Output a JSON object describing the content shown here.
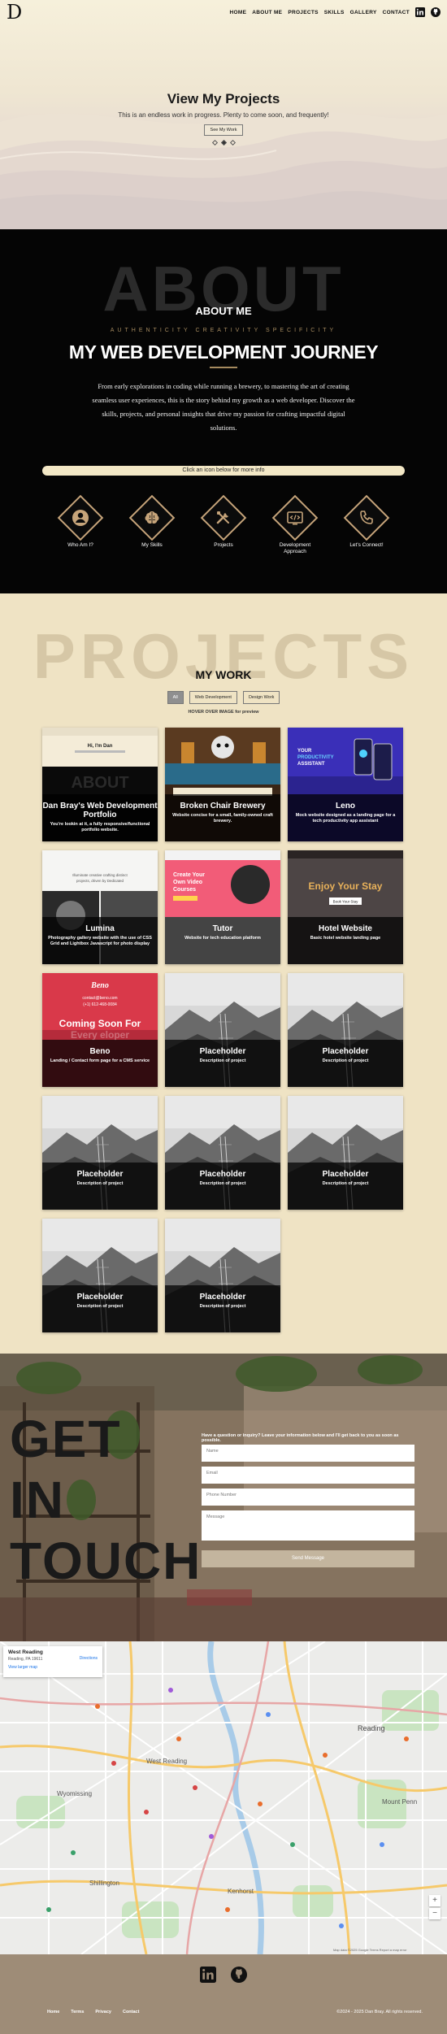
{
  "nav": {
    "logo": "D",
    "links": [
      "HOME",
      "ABOUT ME",
      "PROJECTS",
      "SKILLS",
      "GALLERY",
      "CONTACT"
    ],
    "icons": [
      "linkedin-icon",
      "github-icon"
    ]
  },
  "hero": {
    "title": "View My Projects",
    "subtitle": "This is an endless work in progress. Plenty to come soon, and frequently!",
    "button": "See My Work"
  },
  "about": {
    "bg_word": "ABOUT",
    "heading": "ABOUT ME",
    "tagline": "AUTHENTICITY  CREATIVITY  SPECIFICITY",
    "title": "MY WEB DEVELOPMENT JOURNEY",
    "text": "From early explorations in coding while running a brewery, to mastering the art of creating seamless user experiences, this is the story behind my growth as a web developer. Discover the skills, projects, and personal insights that drive my passion for crafting impactful digital solutions.",
    "bar": "Click an icon below for more info",
    "icons": [
      {
        "label": "Who Am I?",
        "icon": "person-icon"
      },
      {
        "label": "My Skills",
        "icon": "brain-icon"
      },
      {
        "label": "Projects",
        "icon": "tools-icon"
      },
      {
        "label": "Development Approach",
        "icon": "code-icon"
      },
      {
        "label": "Let's Connect!",
        "icon": "phone-icon"
      }
    ]
  },
  "projects": {
    "bg_word": "PROJECTS",
    "heading": "MY WORK",
    "filters": [
      "All",
      "Web Development",
      "Design Work"
    ],
    "hover_note": "HOVER OVER IMAGE for preview",
    "cards": [
      {
        "title": "Dan Bray's Web Development Portfolio",
        "desc": "You're lookin at it, a fully responsive/functional portfolio website.",
        "thumb": "portfolio"
      },
      {
        "title": "Broken Chair Brewery",
        "desc": "Website concise for a small, family-owned craft brewery.",
        "thumb": "brewery"
      },
      {
        "title": "Leno",
        "desc": "Mock website designed as a landing page for a tech productivity app assistant",
        "thumb": "leno"
      },
      {
        "title": "Lumina",
        "desc": "Photography gallery website with the use of CSS Grid and Lightbox Javascript for photo display",
        "thumb": "lumina"
      },
      {
        "title": "Tutor",
        "desc": "Website for tech education platform",
        "thumb": "tutor"
      },
      {
        "title": "Hotel Website",
        "desc": "Basic hotel website landing page",
        "thumb": "hotel"
      },
      {
        "title": "Beno",
        "desc": "Landing / Contact form page for a CMS service",
        "thumb": "beno"
      },
      {
        "title": "Placeholder",
        "desc": "Description of project",
        "thumb": "placeholder"
      },
      {
        "title": "Placeholder",
        "desc": "Description of project",
        "thumb": "placeholder"
      },
      {
        "title": "Placeholder",
        "desc": "Description of project",
        "thumb": "placeholder"
      },
      {
        "title": "Placeholder",
        "desc": "Description of project",
        "thumb": "placeholder"
      },
      {
        "title": "Placeholder",
        "desc": "Description of project",
        "thumb": "placeholder"
      },
      {
        "title": "Placeholder",
        "desc": "Description of project",
        "thumb": "placeholder"
      },
      {
        "title": "Placeholder",
        "desc": "Description of project",
        "thumb": "placeholder"
      }
    ],
    "thumb_text": {
      "portfolio_hi": "Hi, I'm Dan",
      "portfolio_about": "ABOUT",
      "leno_1": "YOUR",
      "leno_2": "PRODUCTIVITY",
      "leno_3": "ASSISTANT",
      "lumina_1": "Illuminate creative crafting distinct",
      "lumina_2": "projects, driven by Dedicated",
      "tutor_1": "Create Your",
      "tutor_2": "Own Video",
      "tutor_3": "Courses",
      "hotel_1": "Enjoy Your Stay",
      "hotel_2": "Book Your Stay",
      "beno_logo": "Beno",
      "beno_email": "contact@beno.com",
      "beno_phone": "(+1) 612-468-0084",
      "beno_soon": "Coming Soon For",
      "beno_ghost": "Every    eloper"
    }
  },
  "contact": {
    "heading": [
      "GET",
      "IN",
      "TOUCH"
    ],
    "intro": "Have a question or inquiry? Leave your information below and I'll get back to you as soon as possible.",
    "fields": [
      "Name",
      "Email",
      "Phone Number",
      "Message"
    ],
    "submit": "Send Message"
  },
  "map": {
    "place": "West Reading",
    "address": "Reading, PA 19611",
    "link": "View larger map",
    "directions": "Directions",
    "zoom_in": "+",
    "zoom_out": "−",
    "labels": [
      "West Reading",
      "Reading",
      "Wyomissing",
      "Shillington",
      "Mount Penn",
      "Kenhorst"
    ],
    "attribution": "Map data ©2025 Google  Terms  Report a map error"
  },
  "footer": {
    "icons": [
      "linkedin-icon",
      "github-icon"
    ],
    "links": [
      "Home",
      "Terms",
      "Privacy",
      "Contact"
    ],
    "copyright": "©2024 - 2025 Dan Bray. All rights reserved."
  },
  "colors": {
    "beige": "#efe3c4",
    "gold": "#c6a47a",
    "black": "#050505",
    "footer": "#9e8c77"
  }
}
